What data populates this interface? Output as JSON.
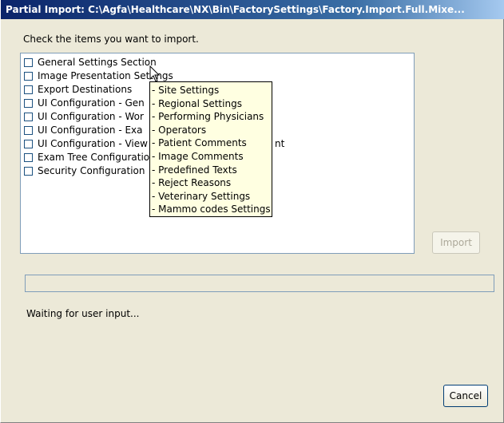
{
  "window": {
    "title": "Partial Import: C:\\Agfa\\Healthcare\\NX\\Bin\\FactorySettings\\Factory.Import.Full.Mixe..."
  },
  "instruction": "Check the items you want to import.",
  "items": [
    {
      "label": "General Settings Section",
      "checked": false
    },
    {
      "label": "Image Presentation Settings",
      "checked": false
    },
    {
      "label": "Export Destinations",
      "checked": false
    },
    {
      "label": "UI Configuration - Gen",
      "checked": false
    },
    {
      "label": "UI Configuration - Wor",
      "checked": false
    },
    {
      "label": "UI Configuration - Exa",
      "checked": false
    },
    {
      "label": "UI Configuration - View",
      "checked": false
    },
    {
      "label": "Exam Tree Configuratio",
      "checked": false
    },
    {
      "label": "Security Configuration",
      "checked": false
    }
  ],
  "item6_suffix": "nt",
  "tooltip": {
    "lines": [
      "- Site Settings",
      "- Regional Settings",
      "- Performing Physicians",
      "- Operators",
      "- Patient Comments",
      "- Image Comments",
      "- Predefined Texts",
      "- Reject Reasons",
      "- Veterinary Settings",
      "- Mammo codes Settings"
    ]
  },
  "buttons": {
    "import_label": "Import",
    "cancel_label": "Cancel"
  },
  "progress": {
    "value": 0
  },
  "status_text": "Waiting for user input..."
}
